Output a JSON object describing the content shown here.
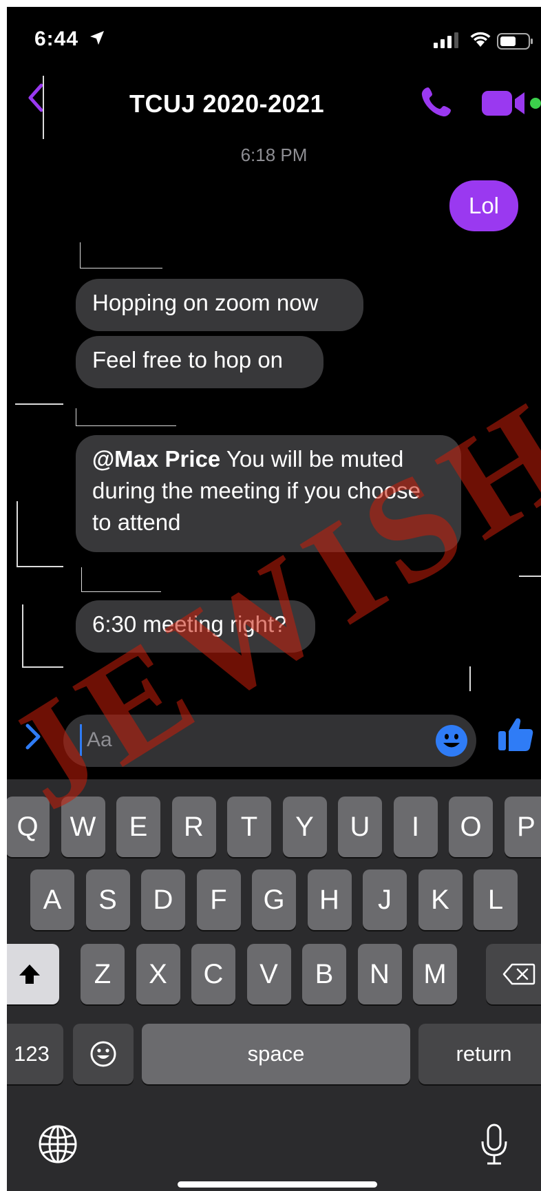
{
  "status_bar": {
    "time": "6:44"
  },
  "header": {
    "title": "TCUJ 2020-2021"
  },
  "messages": {
    "timestamp": "6:18 PM",
    "outgoing_1": "Lol",
    "incoming_1": "Hopping on zoom now",
    "incoming_2": "Feel free to hop on",
    "incoming_3_mention": "@Max Price",
    "incoming_3_text": " You will be muted during the meeting if you choose to attend",
    "incoming_4": "6:30 meeting right?"
  },
  "composer": {
    "placeholder": "Aa"
  },
  "keyboard": {
    "row1": [
      "Q",
      "W",
      "E",
      "R",
      "T",
      "Y",
      "U",
      "I",
      "O",
      "P"
    ],
    "row2": [
      "A",
      "S",
      "D",
      "F",
      "G",
      "H",
      "J",
      "K",
      "L"
    ],
    "row3": [
      "Z",
      "X",
      "C",
      "V",
      "B",
      "N",
      "M"
    ],
    "numbers_label": "123",
    "space_label": "space",
    "return_label": "return"
  },
  "watermark": "JEWISH",
  "colors": {
    "accent": "#9a39f0",
    "blue": "#2f7cf6",
    "active": "#3cd04c"
  },
  "icons": [
    "location-arrow-icon",
    "signal-icon",
    "wifi-icon",
    "battery-icon",
    "back-chevron-icon",
    "phone-icon",
    "video-camera-icon",
    "expand-chevron-icon",
    "emoji-icon",
    "thumbs-up-icon",
    "shift-icon",
    "delete-icon",
    "emoji-keyboard-icon",
    "globe-icon",
    "microphone-icon"
  ]
}
